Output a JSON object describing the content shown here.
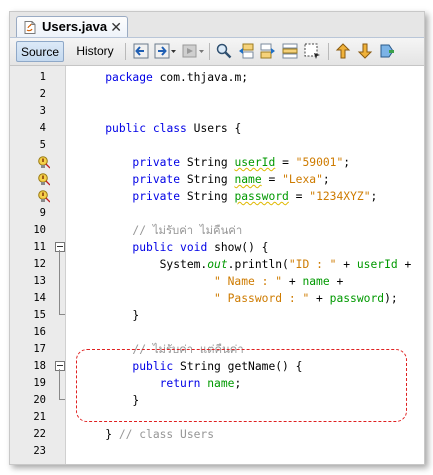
{
  "tab": {
    "filename": "Users.java",
    "close_glyph": "✕"
  },
  "toolbar": {
    "source_label": "Source",
    "history_label": "History",
    "icons": [
      "back-icon",
      "forward-dropdown-icon",
      "run-dropdown-icon",
      "find-icon",
      "find-previous-icon",
      "find-next-icon",
      "toggle-highlight-icon",
      "rectangular-select-icon",
      "prev-bookmark-icon",
      "next-bookmark-icon",
      "toggle-bookmark-icon"
    ]
  },
  "editor": {
    "colors": {
      "keyword": "#0000e6",
      "field": "#009900",
      "string": "#ce7b00",
      "comment": "#969696"
    },
    "lines": [
      {
        "n": "1",
        "tokens": [
          [
            "    ",
            ""
          ],
          [
            "package",
            "kw"
          ],
          [
            " com.thjava.m;",
            ""
          ]
        ]
      },
      {
        "n": "2",
        "tokens": []
      },
      {
        "n": "3",
        "tokens": []
      },
      {
        "n": "4",
        "tokens": [
          [
            "    ",
            ""
          ],
          [
            "public",
            "kw"
          ],
          [
            " ",
            ""
          ],
          [
            "class",
            "kw"
          ],
          [
            " Users {",
            ""
          ]
        ]
      },
      {
        "n": "5",
        "tokens": []
      },
      {
        "n": "6",
        "warn": true,
        "tokens": [
          [
            "        ",
            ""
          ],
          [
            "private",
            "kw"
          ],
          [
            " String ",
            ""
          ],
          [
            "userId",
            "fld wavy"
          ],
          [
            " = ",
            ""
          ],
          [
            "\"59001\"",
            "str"
          ],
          [
            ";",
            ""
          ]
        ]
      },
      {
        "n": "7",
        "warn": true,
        "tokens": [
          [
            "        ",
            ""
          ],
          [
            "private",
            "kw"
          ],
          [
            " String ",
            ""
          ],
          [
            "name",
            "fld wavy"
          ],
          [
            " = ",
            ""
          ],
          [
            "\"Lexa\"",
            "str"
          ],
          [
            ";",
            ""
          ]
        ]
      },
      {
        "n": "8",
        "warn": true,
        "tokens": [
          [
            "        ",
            ""
          ],
          [
            "private",
            "kw"
          ],
          [
            " String ",
            ""
          ],
          [
            "password",
            "fld wavy"
          ],
          [
            " = ",
            ""
          ],
          [
            "\"1234XYZ\"",
            "str"
          ],
          [
            ";",
            ""
          ]
        ]
      },
      {
        "n": "9",
        "tokens": []
      },
      {
        "n": "10",
        "tokens": [
          [
            "        ",
            ""
          ],
          [
            "// ไม่รับค่า ไม่คืนค่า",
            "cmt"
          ]
        ]
      },
      {
        "n": "11",
        "fold": true,
        "tokens": [
          [
            "        ",
            ""
          ],
          [
            "public",
            "kw"
          ],
          [
            " ",
            ""
          ],
          [
            "void",
            "kw"
          ],
          [
            " show() {",
            ""
          ]
        ]
      },
      {
        "n": "12",
        "tokens": [
          [
            "            System.",
            ""
          ],
          [
            "out",
            "fld ital"
          ],
          [
            ".println(",
            ""
          ],
          [
            "\"ID : \"",
            "str"
          ],
          [
            " + ",
            ""
          ],
          [
            "userId",
            "fld"
          ],
          [
            " +",
            ""
          ]
        ]
      },
      {
        "n": "13",
        "tokens": [
          [
            "                    ",
            ""
          ],
          [
            "\" Name : \"",
            "str"
          ],
          [
            " + ",
            ""
          ],
          [
            "name",
            "fld"
          ],
          [
            " +",
            ""
          ]
        ]
      },
      {
        "n": "14",
        "tokens": [
          [
            "                    ",
            ""
          ],
          [
            "\" Password : \"",
            "str"
          ],
          [
            " + ",
            ""
          ],
          [
            "password",
            "fld"
          ],
          [
            ");",
            ""
          ]
        ]
      },
      {
        "n": "15",
        "tokens": [
          [
            "        }",
            ""
          ]
        ]
      },
      {
        "n": "16",
        "tokens": []
      },
      {
        "n": "17",
        "tokens": [
          [
            "        ",
            ""
          ],
          [
            "// ไม่รับค่า แต่คืนค่า",
            "cmt"
          ]
        ]
      },
      {
        "n": "18",
        "fold": true,
        "tokens": [
          [
            "        ",
            ""
          ],
          [
            "public",
            "kw"
          ],
          [
            " String getName() {",
            ""
          ]
        ]
      },
      {
        "n": "19",
        "tokens": [
          [
            "            ",
            ""
          ],
          [
            "return",
            "kw"
          ],
          [
            " ",
            ""
          ],
          [
            "name",
            "fld"
          ],
          [
            ";",
            ""
          ]
        ]
      },
      {
        "n": "20",
        "tokens": [
          [
            "        }",
            ""
          ]
        ]
      },
      {
        "n": "21",
        "tokens": []
      },
      {
        "n": "22",
        "tokens": [
          [
            "    } ",
            ""
          ],
          [
            "// class Users",
            "cmt"
          ]
        ]
      },
      {
        "n": "23",
        "tokens": []
      }
    ]
  }
}
